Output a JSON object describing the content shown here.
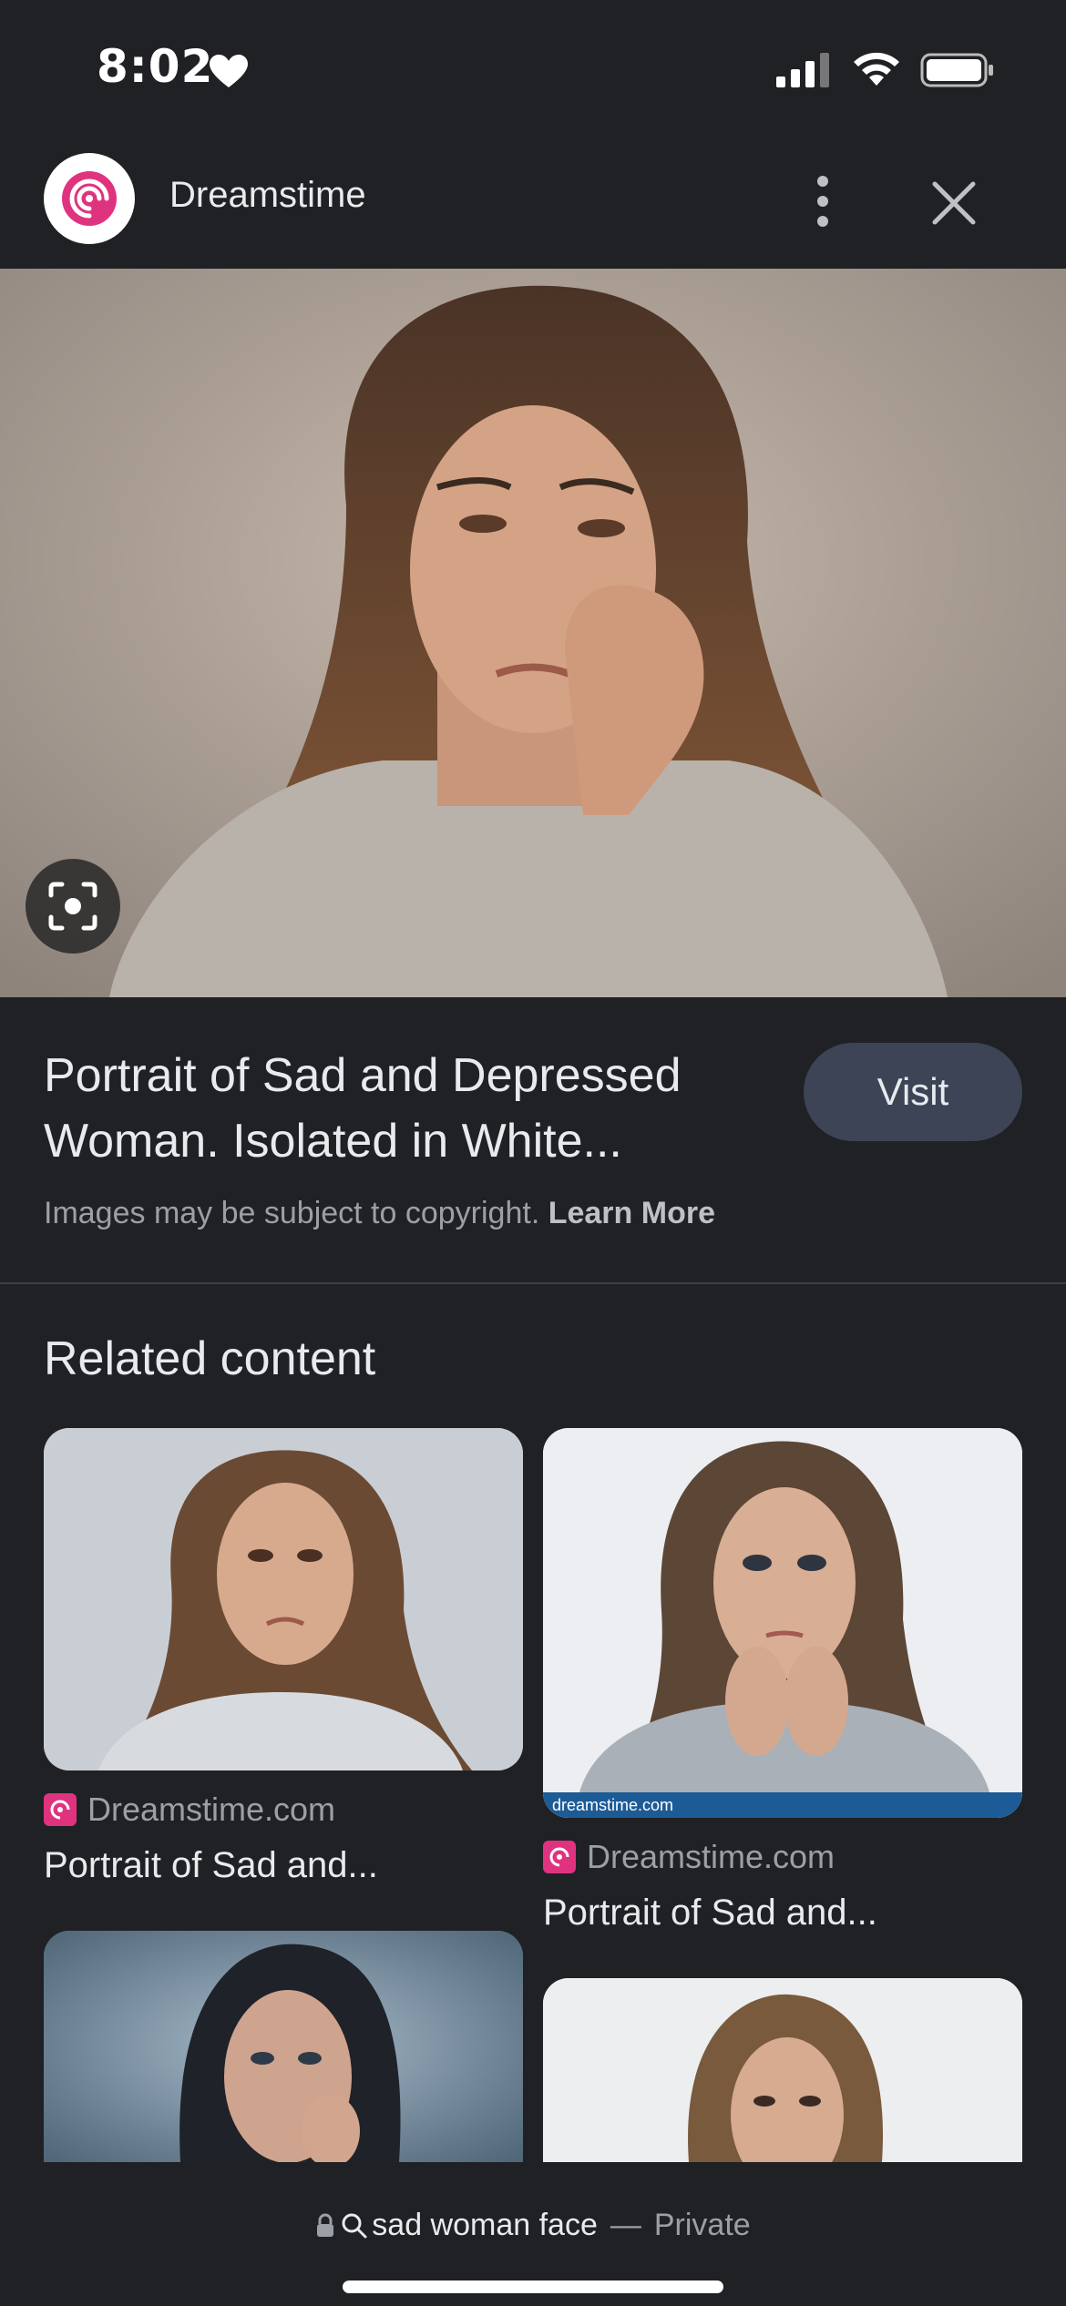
{
  "status_bar": {
    "time": "8:02",
    "icons": [
      "heart-icon",
      "signal-icon",
      "wifi-icon",
      "battery-icon"
    ]
  },
  "header": {
    "site_name": "Dreamstime",
    "logo_icon": "dreamstime-logo",
    "more_icon": "more-vertical-icon",
    "close_icon": "close-icon"
  },
  "main_image": {
    "lens_icon": "lens-icon"
  },
  "info": {
    "title": "Portrait of Sad and Depressed Woman. Isolated in White...",
    "visit_label": "Visit",
    "copyright_text": "Images may be subject to copyright.",
    "learn_more": "Learn More"
  },
  "related": {
    "heading": "Related content",
    "items": [
      {
        "source": "Dreamstime.com",
        "title": "Portrait of Sad and..."
      },
      {
        "source": "Dreamstime.com",
        "title": "Portrait of Sad and..."
      },
      {
        "source": "",
        "title": ""
      },
      {
        "source": "",
        "title": ""
      }
    ],
    "watermark": "dreamstime.com"
  },
  "bottom_bar": {
    "query": "sad woman face",
    "separator": "—",
    "mode": "Private"
  },
  "colors": {
    "background": "#202124",
    "visit_button": "#3c4456",
    "brand_pink": "#e0337f"
  }
}
